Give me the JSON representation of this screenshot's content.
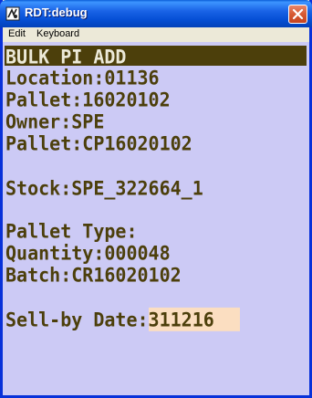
{
  "window": {
    "title": "RDT:debug",
    "close_icon": "close-icon"
  },
  "menu": {
    "items": [
      "Edit",
      "Keyboard"
    ]
  },
  "screen": {
    "header": "BULK PI ADD",
    "location": "Location:01136",
    "pallet_1": "Pallet:16020102",
    "owner": "Owner:SPE",
    "pallet_2": "Pallet:CP16020102",
    "stock": "Stock:SPE_322664_1",
    "pallet_type": "Pallet Type:",
    "quantity": "Quantity:000048",
    "batch": "Batch:CR16020102",
    "sell_by_label": "Sell-by Date:",
    "sell_by_value": "311216"
  },
  "colors": {
    "screen_background": "#cccaf5",
    "text": "#4c3f0b",
    "header_background": "#4c3f0b",
    "input_highlight": "#fbdec1",
    "titlebar": "#0650d6"
  }
}
